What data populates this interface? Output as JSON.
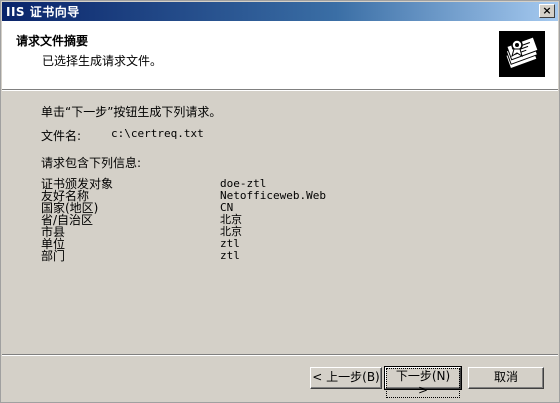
{
  "window": {
    "title": "IIS 证书向导",
    "close_label": "×"
  },
  "header": {
    "title": "请求文件摘要",
    "subtitle": "已选择生成请求文件。",
    "icon": "certificate-icon"
  },
  "body": {
    "instruction": "单击“下一步”按钮生成下列请求。",
    "filename_label": "文件名:",
    "filename_value": "c:\\certreq.txt",
    "info_label": "请求包含下列信息:",
    "info": [
      {
        "key": "证书颁发对象",
        "value": "doe-ztl"
      },
      {
        "key": "友好名称",
        "value": "Netofficeweb.Web"
      },
      {
        "key": "国家(地区)",
        "value": "CN"
      },
      {
        "key": "省/自治区",
        "value": "北京"
      },
      {
        "key": "市县",
        "value": "北京"
      },
      {
        "key": "单位",
        "value": "ztl"
      },
      {
        "key": "部门",
        "value": "ztl"
      }
    ]
  },
  "buttons": {
    "back": "< 上一步(B)",
    "next": "下一步(N) >",
    "cancel": "取消"
  },
  "colors": {
    "titlebar_start": "#0a246a",
    "titlebar_end": "#a6caf0",
    "dialog_bg": "#d4d0c8"
  }
}
